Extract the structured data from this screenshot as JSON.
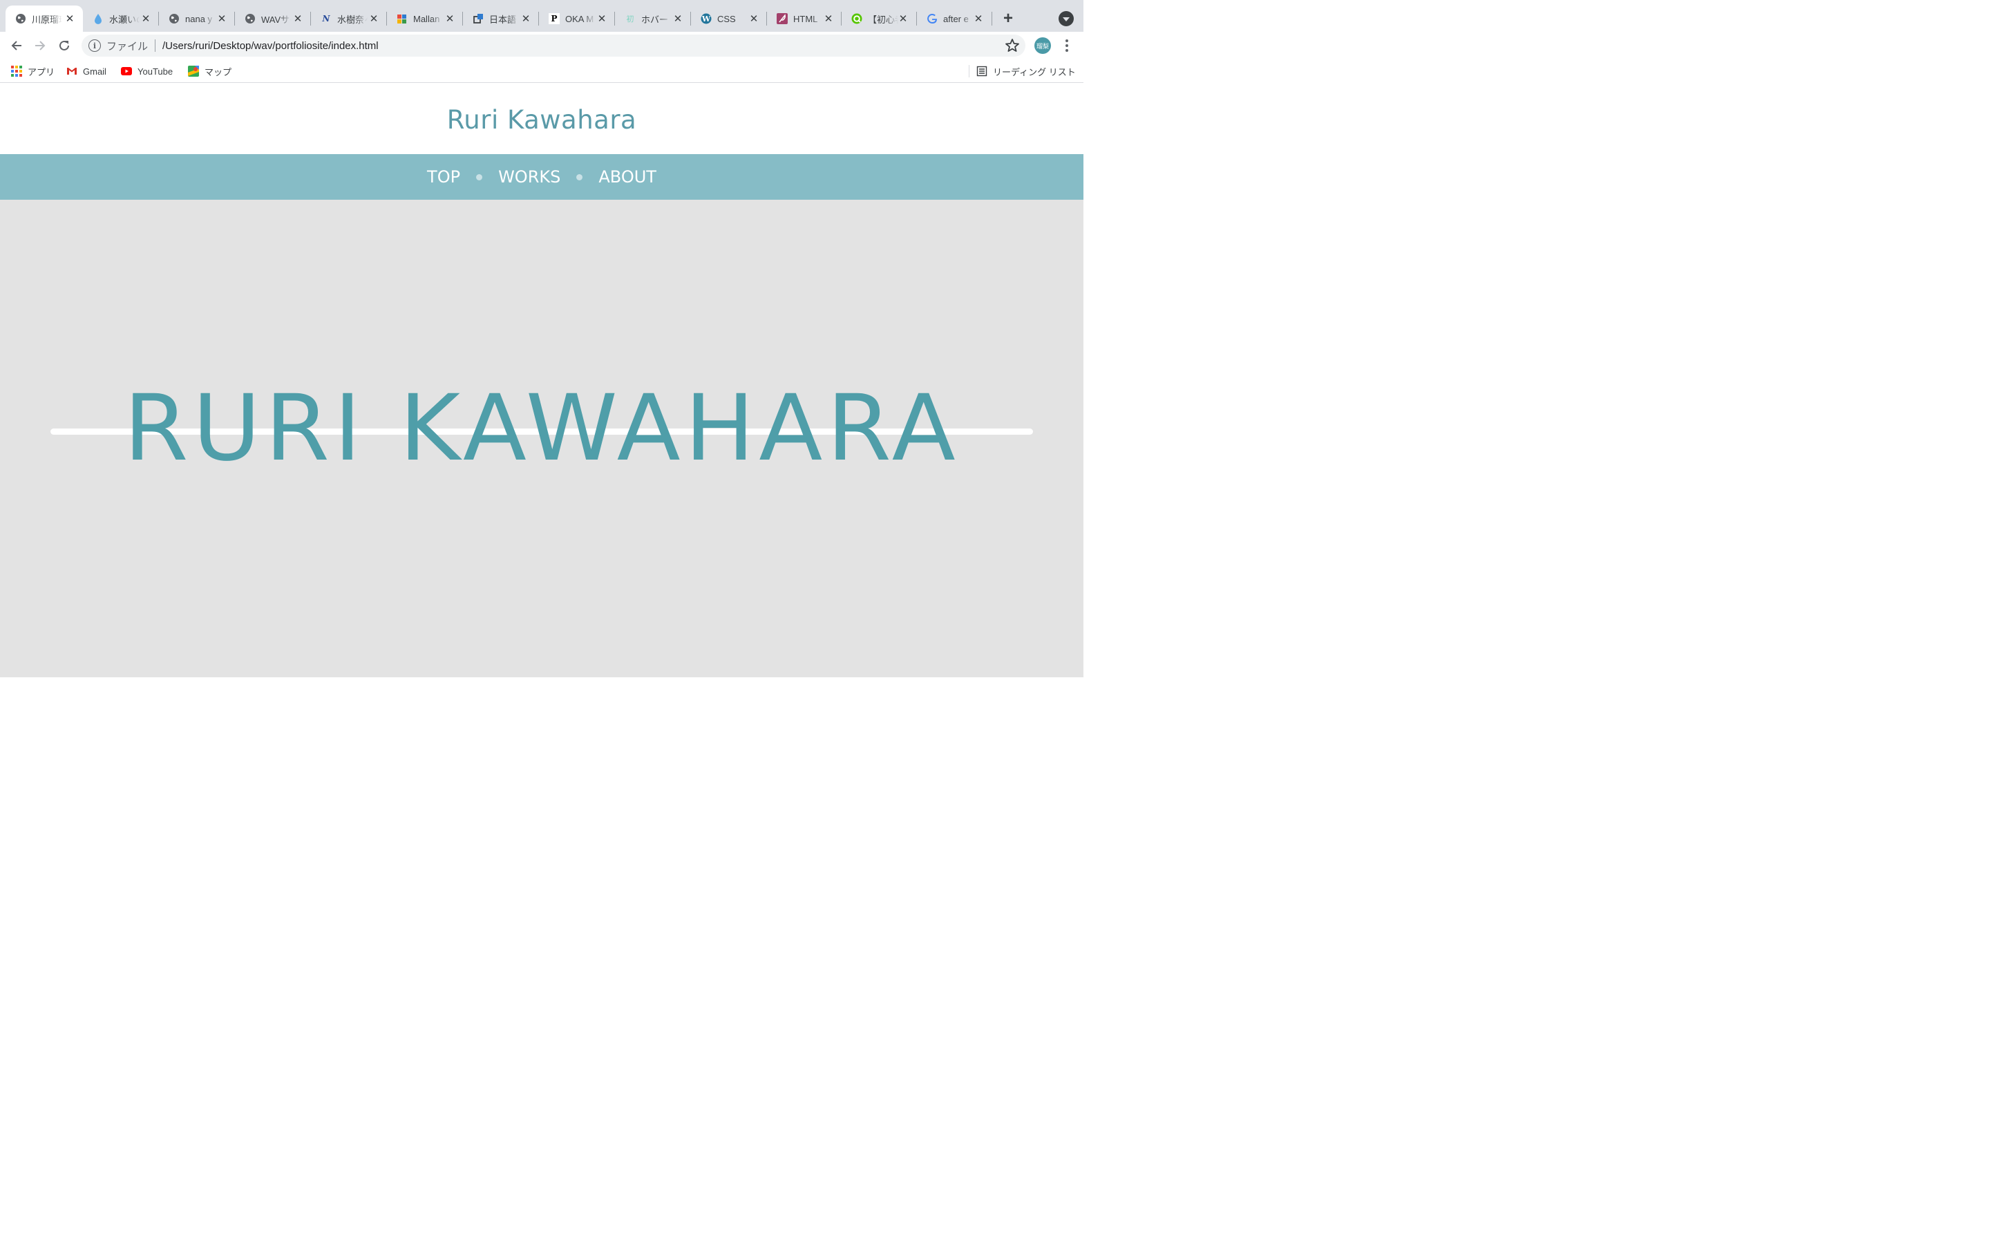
{
  "browser": {
    "tabs": [
      {
        "title": "川原瑠璃",
        "favicon": "globe-icon",
        "active": true
      },
      {
        "title": "水瀬いのり",
        "favicon": "water-drop-icon"
      },
      {
        "title": "nana y",
        "favicon": "globe-icon"
      },
      {
        "title": "WAVサイト",
        "favicon": "globe-icon"
      },
      {
        "title": "水樹奈々",
        "favicon": "n-logo-icon"
      },
      {
        "title": "Mallan",
        "favicon": "colorful-blocks-icon"
      },
      {
        "title": "日本語",
        "favicon": "external-link-icon"
      },
      {
        "title": "OKA M",
        "favicon": "p-letter-icon"
      },
      {
        "title": "ホバー",
        "favicon": "kanji-hatsu-icon"
      },
      {
        "title": "CSS",
        "favicon": "wordpress-icon"
      },
      {
        "title": "HTML",
        "favicon": "feather-icon"
      },
      {
        "title": "【初心者",
        "favicon": "q-logo-icon"
      },
      {
        "title": "after e",
        "favicon": "google-icon"
      }
    ],
    "address": {
      "scheme_label": "ファイル",
      "url": "/Users/ruri/Desktop/wav/portfoliosite/index.html"
    },
    "profile_label": "瑠梨",
    "bookmarks": [
      {
        "label": "アプリ",
        "icon": "apps-grid-icon"
      },
      {
        "label": "Gmail",
        "icon": "gmail-icon"
      },
      {
        "label": "YouTube",
        "icon": "youtube-icon"
      },
      {
        "label": "マップ",
        "icon": "maps-icon"
      }
    ],
    "reading_list_label": "リーディング リスト"
  },
  "site": {
    "title": "Ruri Kawahara",
    "nav": [
      "TOP",
      "WORKS",
      "ABOUT"
    ],
    "hero_title": "RURI KAWAHARA",
    "colors": {
      "title": "#5a9aa8",
      "nav_bg": "#86bcc6",
      "hero_bg": "#e3e3e3",
      "hero_text": "#4f9ea9"
    }
  }
}
